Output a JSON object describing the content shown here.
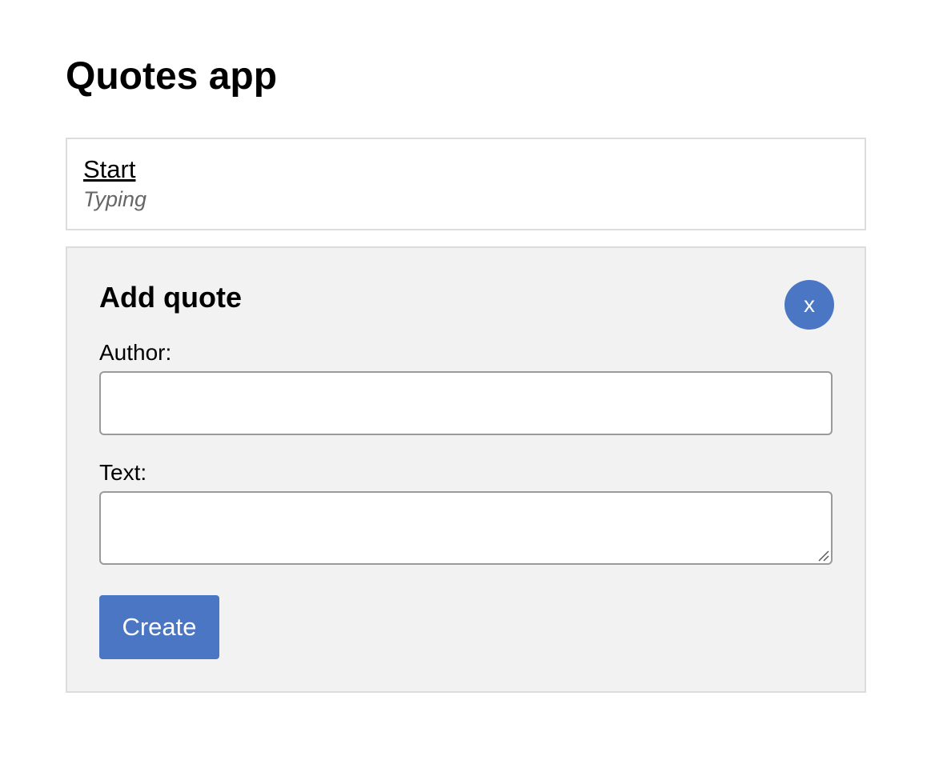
{
  "header": {
    "title": "Quotes app"
  },
  "nav": {
    "link_label": "Start",
    "status": "Typing"
  },
  "form": {
    "heading": "Add quote",
    "close_label": "x",
    "author_label": "Author:",
    "author_value": "",
    "text_label": "Text:",
    "text_value": "",
    "submit_label": "Create"
  },
  "colors": {
    "accent": "#4a76c4",
    "panel_background": "#f2f2f2",
    "border": "#dcdcdc",
    "status_text": "#666666"
  },
  "icons": {
    "resize_handle": "resize-grip-icon"
  }
}
